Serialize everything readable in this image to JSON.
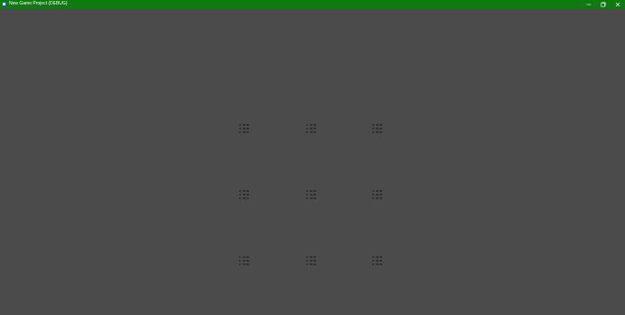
{
  "window": {
    "title": "New Game Project (DEBUG)",
    "app_icon": "godot-app-icon",
    "controls": {
      "minimize_icon": "minimize-icon",
      "restore_icon": "restore-icon",
      "close_icon": "close-icon"
    },
    "titlebar_color": "#0f7a0f",
    "background_color": "#4b4b4b"
  },
  "grid": {
    "rows": 3,
    "columns": 3,
    "cell_icon": "dot-grid-icon",
    "dot_color": "#2c2c2c"
  }
}
